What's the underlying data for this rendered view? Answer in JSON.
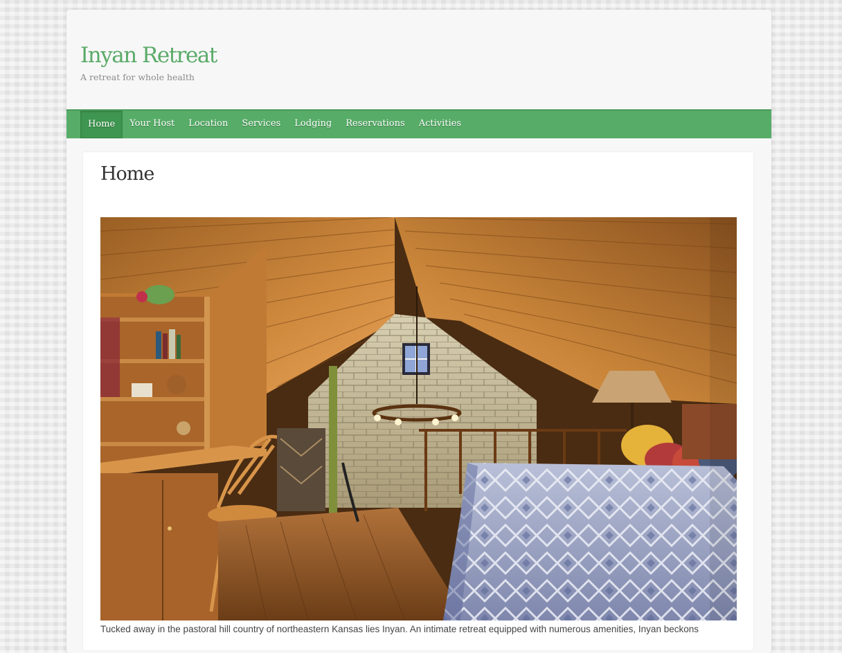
{
  "site": {
    "title": "Inyan Retreat",
    "tagline": "A retreat for whole health"
  },
  "nav": {
    "items": [
      {
        "label": "Home",
        "active": true
      },
      {
        "label": "Your Host",
        "active": false
      },
      {
        "label": "Location",
        "active": false
      },
      {
        "label": "Services",
        "active": false
      },
      {
        "label": "Lodging",
        "active": false
      },
      {
        "label": "Reservations",
        "active": false
      },
      {
        "label": "Activities",
        "active": false
      }
    ]
  },
  "page": {
    "title": "Home",
    "intro": "Tucked away in the pastoral hill country of northeastern Kansas lies Inyan. An intimate retreat equipped with numerous amenities, Inyan beckons"
  },
  "colors": {
    "brand_green": "#5aaa68",
    "nav_green": "#57ad68",
    "nav_active": "#3f9650"
  }
}
